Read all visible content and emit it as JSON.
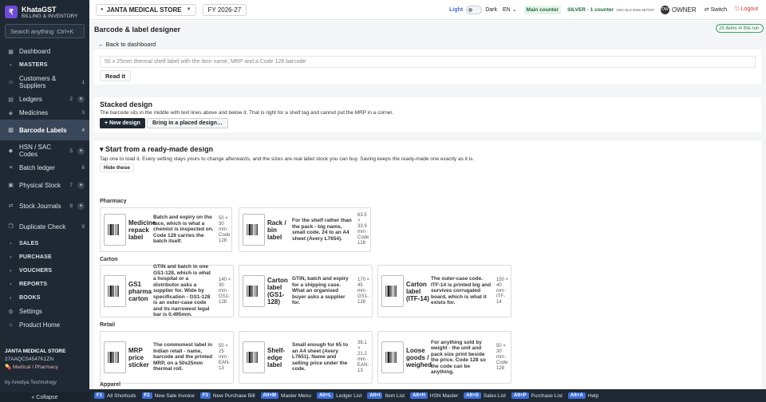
{
  "app": {
    "name": "KhataGST",
    "tagline": "BILLING & INVENTORY",
    "logo_letter": "₹"
  },
  "search": {
    "placeholder": "Search anything",
    "shortcut": "Ctrl+K"
  },
  "sidebar": {
    "items": [
      {
        "label": "Dashboard",
        "icon": "grid-icon"
      },
      {
        "label": "MASTERS",
        "section": true
      },
      {
        "label": "Customers & Suppliers",
        "count": "1",
        "icon": "users-icon"
      },
      {
        "label": "Ledgers",
        "count": "2",
        "plus": true,
        "icon": "book-icon"
      },
      {
        "label": "Medicines",
        "count": "3",
        "icon": "cube-icon"
      },
      {
        "label": "Barcode Labels",
        "count": "4",
        "active": true,
        "icon": "barcode-icon"
      },
      {
        "label": "HSN / SAC Codes",
        "count": "5",
        "plus": true,
        "icon": "tag-icon"
      },
      {
        "label": "Batch ledger",
        "count": "6",
        "icon": "layers-icon"
      },
      {
        "label": "Physical Stock",
        "count": "7",
        "plus": true,
        "icon": "clipboard-icon"
      },
      {
        "label": "Stock Journals",
        "count": "8",
        "plus": true,
        "icon": "arrows-icon"
      },
      {
        "label": "Duplicate Check",
        "count": "9",
        "icon": "copy-icon"
      },
      {
        "label": "SALES",
        "section": true
      },
      {
        "label": "PURCHASE",
        "section": true
      },
      {
        "label": "VOUCHERS",
        "section": true
      },
      {
        "label": "REPORTS",
        "section": true
      },
      {
        "label": "BOOKS",
        "section": true
      },
      {
        "label": "Settings",
        "icon": "gear-icon"
      },
      {
        "label": "Product Home",
        "icon": "home-icon"
      }
    ],
    "store_name": "JANTA MEDICAL STORE",
    "gstin": "27AAQCS4547K1ZN",
    "category": "Medical / Pharmacy",
    "by": "by Anedya Technology",
    "collapse": "« Collapse"
  },
  "topbar": {
    "store": "JANTA MEDICAL STORE",
    "fy": "FY 2026-27",
    "light": "Light",
    "dark": "Dark",
    "lang": "EN",
    "counter": "Main counter",
    "plan": "SILVER · 1 counter",
    "license": "ANG-SLV-2026-4E7F97",
    "owner_badge": "OW",
    "owner": "OWNER",
    "switch": "⇄ Switch",
    "logout": "⎋ Logout"
  },
  "page": {
    "title": "Barcode & label designer",
    "count_badge": "25 items in this run",
    "back": "← Back to dashboard",
    "prompt_placeholder": "50 x 25mm thermal shelf label with the item name, MRP and a Code 128 barcode",
    "read_button": "Read it",
    "stacked": {
      "title": "Stacked design",
      "desc": "The barcode sits in the middle with text lines above and below it. That is right for a shelf tag and cannot put the MRP in a corner.",
      "new_button": "+ New design",
      "bring_button": "Bring in a placed design…"
    },
    "ready": {
      "title": "▾ Start from a ready-made design",
      "desc": "Tap one to load it. Every setting stays yours to change afterwards, and the sizes are real label stock you can buy. Saving keeps the ready-made one exactly as it is.",
      "hide_button": "Hide these",
      "categories": [
        {
          "name": "Pharmacy",
          "templates": [
            {
              "name": "Medicine repack label",
              "desc": "Batch and expiry on the face, which is what a chemist is inspected on. Code 128 carries the batch itself.",
              "size": "50 × 30 mm · Code 128"
            },
            {
              "name": "Rack / bin label",
              "desc": "For the shelf rather than the pack - big name, small code. 24 to an A4 sheet (Avery L7654).",
              "size": "63.5 × 33.9 mm · Code 128"
            }
          ]
        },
        {
          "name": "Carton",
          "templates": [
            {
              "name": "GS1 pharma carton",
              "desc": "GTIN and batch in one GS1-128, which is what a hospital or a distributor asks a supplier for. Wide by specification - GS1-128 is an outer-case code and its narrowest legal bar is 0.495mm.",
              "size": "140 × 30 mm · GS1-128"
            },
            {
              "name": "Carton label (GS1-128)",
              "desc": "GTIN, batch and expiry for a shipping case. What an organised buyer asks a supplier for.",
              "size": "170 × 45 mm · GS1-128"
            },
            {
              "name": "Carton label (ITF-14)",
              "desc": "The outer-case code. ITF-14 is printed big and survives corrugated board, which is what it exists for.",
              "size": "150 × 40 mm · ITF-14"
            }
          ]
        },
        {
          "name": "Retail",
          "templates": [
            {
              "name": "MRP price sticker",
              "desc": "The commonest label in Indian retail - name, barcode and the printed MRP, on a 50x25mm thermal roll.",
              "size": "50 × 25 mm · EAN-13"
            },
            {
              "name": "Shelf-edge label",
              "desc": "Small enough for 65 to an A4 sheet (Avery L7651). Name and selling price under the code.",
              "size": "38.1 × 21.2 mm · EAN-13"
            },
            {
              "name": "Loose goods / weighed",
              "desc": "For anything sold by weight - the unit and pack size print beside the price. Code 128 so the code can be anything.",
              "size": "50 × 30 mm · Code 128"
            }
          ]
        },
        {
          "name": "Apparel",
          "templates": []
        }
      ]
    }
  },
  "shortcuts": [
    {
      "key": "F1",
      "label": "All Shortcuts"
    },
    {
      "key": "F2",
      "label": "New Sale Invoice"
    },
    {
      "key": "F3",
      "label": "New Purchase Bill"
    },
    {
      "key": "Alt+M",
      "label": "Master Menu"
    },
    {
      "key": "Alt+L",
      "label": "Ledger List"
    },
    {
      "key": "Alt+I",
      "label": "Item List"
    },
    {
      "key": "Alt+H",
      "label": "HSN Master"
    },
    {
      "key": "Alt+S",
      "label": "Sales List"
    },
    {
      "key": "Alt+P",
      "label": "Purchase List"
    },
    {
      "key": "Alt+A",
      "label": "Help"
    }
  ]
}
